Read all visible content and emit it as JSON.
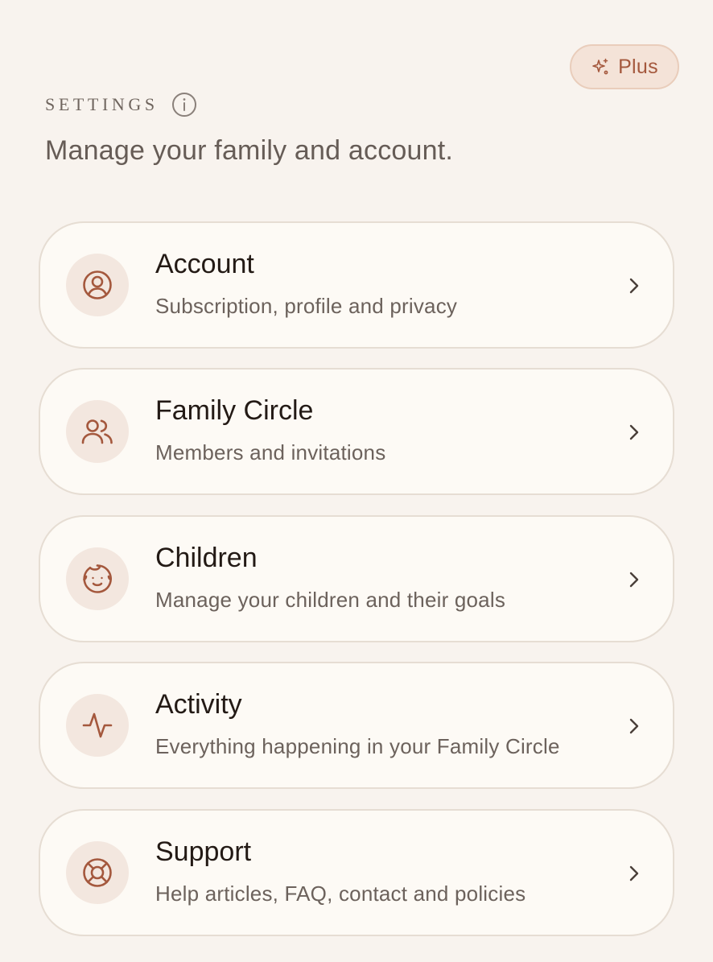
{
  "header": {
    "plus_button": {
      "label": "Plus",
      "icon": "sparkles-icon"
    },
    "section_label": "SETTINGS",
    "info_icon": "info-icon",
    "subtitle": "Manage your family and account."
  },
  "colors": {
    "background": "#f8f3ee",
    "card_background": "#fdfaf5",
    "card_border": "#e6ddd3",
    "accent": "#a4583d",
    "icon_circle": "#f3e7df",
    "plus_background": "#f4e3d8"
  },
  "menu": {
    "items": [
      {
        "title": "Account",
        "description": "Subscription, profile and privacy",
        "icon": "user-circle-icon"
      },
      {
        "title": "Family Circle",
        "description": "Members and invitations",
        "icon": "users-icon"
      },
      {
        "title": "Children",
        "description": "Manage your children and their goals",
        "icon": "baby-face-icon"
      },
      {
        "title": "Activity",
        "description": "Everything happening in your Family Circle",
        "icon": "activity-pulse-icon"
      },
      {
        "title": "Support",
        "description": "Help articles, FAQ, contact and policies",
        "icon": "lifebuoy-icon"
      }
    ]
  }
}
